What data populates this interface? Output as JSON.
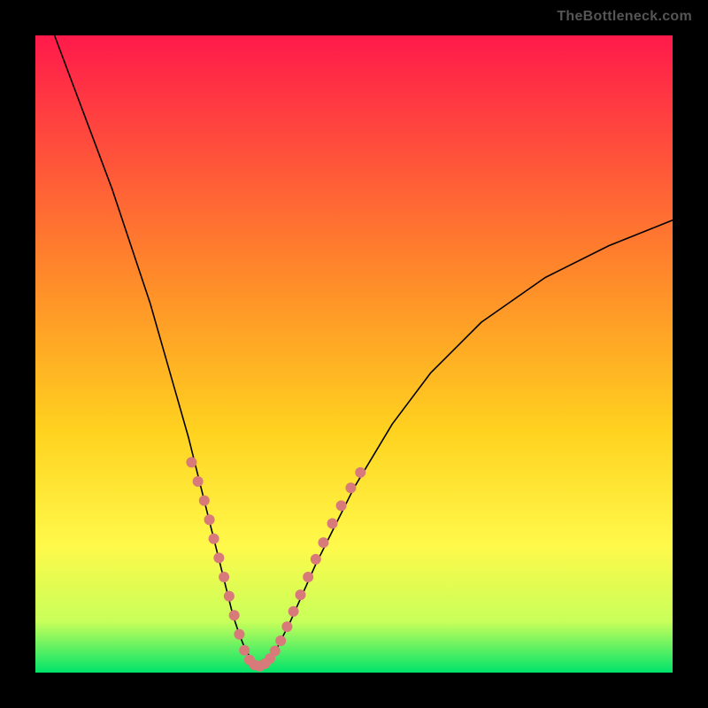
{
  "watermark": "TheBottleneck.com",
  "chart_data": {
    "type": "line",
    "title": "",
    "xlabel": "",
    "ylabel": "",
    "xlim": [
      0,
      100
    ],
    "ylim": [
      0,
      100
    ],
    "grid": false,
    "legend": false,
    "background_gradient": {
      "stops": [
        {
          "offset": 0.0,
          "color": "#ff1a4b"
        },
        {
          "offset": 0.38,
          "color": "#ff8a2a"
        },
        {
          "offset": 0.62,
          "color": "#ffd21f"
        },
        {
          "offset": 0.8,
          "color": "#fff94a"
        },
        {
          "offset": 0.92,
          "color": "#c8ff5a"
        },
        {
          "offset": 1.0,
          "color": "#00e36a"
        }
      ]
    },
    "series": [
      {
        "name": "curve",
        "color": "#000000",
        "width": 1.6,
        "x": [
          3,
          6,
          9,
          12,
          15,
          18,
          20,
          22,
          24,
          26,
          28,
          30,
          31,
          32,
          33,
          34,
          35,
          36,
          38,
          40,
          44,
          50,
          56,
          62,
          70,
          80,
          90,
          100
        ],
        "y": [
          100,
          92,
          84,
          76,
          67,
          58,
          51,
          44,
          37,
          29,
          21,
          13,
          9,
          6,
          3.5,
          2,
          1,
          2,
          4,
          8,
          17,
          29,
          39,
          47,
          55,
          62,
          67,
          71
        ]
      }
    ],
    "markers": {
      "name": "v-bottom-dots",
      "color": "#d87a7a",
      "radius": 6,
      "points": [
        {
          "x": 24.5,
          "y": 33
        },
        {
          "x": 25.5,
          "y": 30
        },
        {
          "x": 26.5,
          "y": 27
        },
        {
          "x": 27.3,
          "y": 24
        },
        {
          "x": 28.0,
          "y": 21
        },
        {
          "x": 28.8,
          "y": 18
        },
        {
          "x": 29.6,
          "y": 15
        },
        {
          "x": 30.4,
          "y": 12
        },
        {
          "x": 31.2,
          "y": 9
        },
        {
          "x": 32.0,
          "y": 6
        },
        {
          "x": 32.8,
          "y": 3.5
        },
        {
          "x": 33.6,
          "y": 2
        },
        {
          "x": 34.4,
          "y": 1.2
        },
        {
          "x": 35.2,
          "y": 1.0
        },
        {
          "x": 36.0,
          "y": 1.4
        },
        {
          "x": 36.8,
          "y": 2.2
        },
        {
          "x": 37.6,
          "y": 3.4
        },
        {
          "x": 38.5,
          "y": 5.0
        },
        {
          "x": 39.5,
          "y": 7.2
        },
        {
          "x": 40.5,
          "y": 9.6
        },
        {
          "x": 41.6,
          "y": 12.2
        },
        {
          "x": 42.8,
          "y": 15.0
        },
        {
          "x": 44.0,
          "y": 17.8
        },
        {
          "x": 45.2,
          "y": 20.4
        },
        {
          "x": 46.6,
          "y": 23.4
        },
        {
          "x": 48.0,
          "y": 26.2
        },
        {
          "x": 49.5,
          "y": 29.0
        },
        {
          "x": 51.0,
          "y": 31.4
        }
      ]
    }
  }
}
